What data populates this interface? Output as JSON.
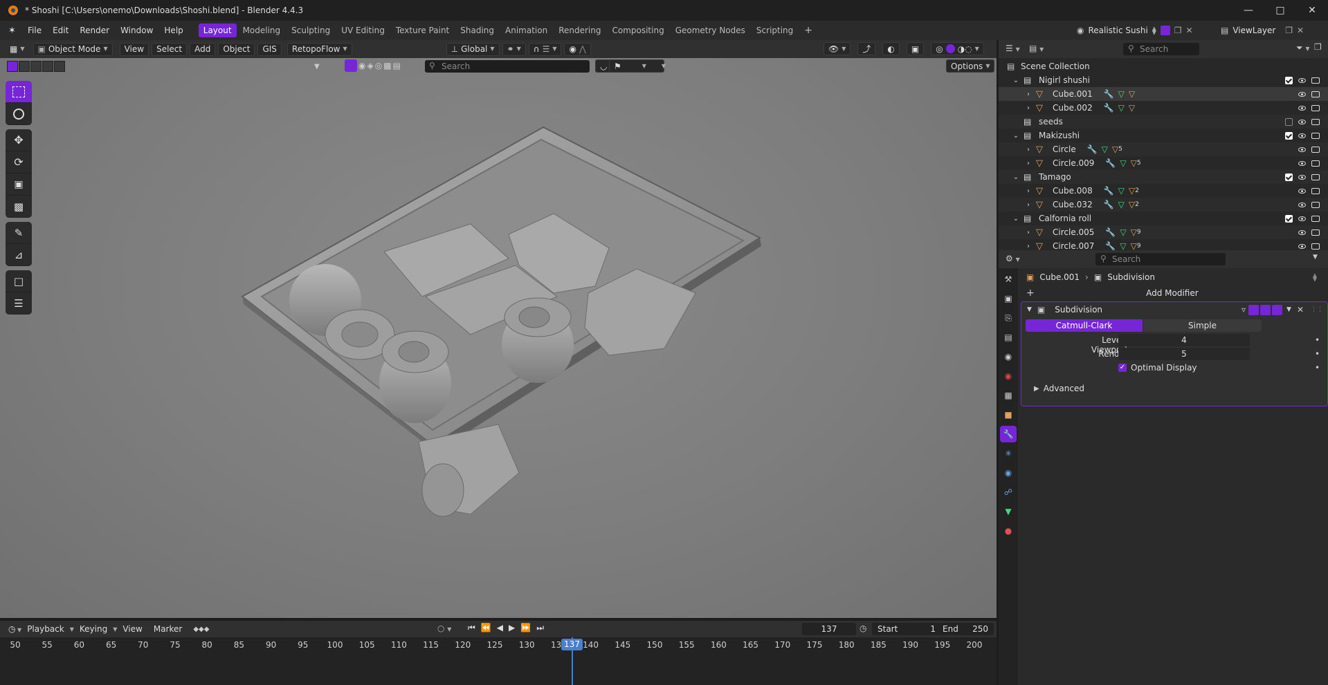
{
  "window": {
    "title": "* Shoshi [C:\\Users\\onemo\\Downloads\\Shoshi.blend] - Blender 4.4.3"
  },
  "menu": [
    "File",
    "Edit",
    "Render",
    "Window",
    "Help"
  ],
  "workspaces": [
    "Layout",
    "Modeling",
    "Sculpting",
    "UV Editing",
    "Texture Paint",
    "Shading",
    "Animation",
    "Rendering",
    "Compositing",
    "Geometry Nodes",
    "Scripting"
  ],
  "active_workspace": "Layout",
  "scene_name": "Realistic Sushi",
  "view_layer": "ViewLayer",
  "viewport_header": {
    "mode": "Object Mode",
    "menus": [
      "View",
      "Select",
      "Add",
      "Object",
      "GIS"
    ],
    "addon": "RetopoFlow",
    "transform_orientation": "Global",
    "search_placeholder": "Search",
    "options": "Options"
  },
  "outliner": {
    "search_placeholder": "Search",
    "root": "Scene Collection",
    "rows": [
      {
        "label": "Nigirl shushi",
        "kind": "collection",
        "indent": 0,
        "checked": true
      },
      {
        "label": "Cube.001",
        "kind": "object",
        "indent": 1,
        "sub": ""
      },
      {
        "label": "Cube.002",
        "kind": "object",
        "indent": 1,
        "sub": ""
      },
      {
        "label": "seeds",
        "kind": "collection",
        "indent": 0,
        "checked": false
      },
      {
        "label": "Makizushi",
        "kind": "collection",
        "indent": 0,
        "checked": true
      },
      {
        "label": "Circle",
        "kind": "object",
        "indent": 1,
        "sub": "5"
      },
      {
        "label": "Circle.009",
        "kind": "object",
        "indent": 1,
        "sub": "5"
      },
      {
        "label": "Tamago",
        "kind": "collection",
        "indent": 0,
        "checked": true
      },
      {
        "label": "Cube.008",
        "kind": "object",
        "indent": 1,
        "sub": "2"
      },
      {
        "label": "Cube.032",
        "kind": "object",
        "indent": 1,
        "sub": "2"
      },
      {
        "label": "Calfornia roll",
        "kind": "collection",
        "indent": 0,
        "checked": true
      },
      {
        "label": "Circle.005",
        "kind": "object",
        "indent": 1,
        "sub": "9"
      },
      {
        "label": "Circle.007",
        "kind": "object",
        "indent": 1,
        "sub": "9"
      }
    ]
  },
  "properties": {
    "search_placeholder": "Search",
    "breadcrumb_object": "Cube.001",
    "breadcrumb_modifier": "Subdivision",
    "add_modifier": "Add Modifier",
    "modifier": {
      "name": "Subdivision",
      "algorithms": [
        "Catmull-Clark",
        "Simple"
      ],
      "active_algorithm": "Catmull-Clark",
      "levels_viewport_label": "Levels Viewport",
      "levels_viewport": "4",
      "render_label": "Render",
      "render": "5",
      "optimal_display_label": "Optimal Display",
      "optimal_display": true,
      "advanced_label": "Advanced"
    }
  },
  "timeline": {
    "menus": [
      "Playback",
      "Keying",
      "View",
      "Marker"
    ],
    "current_frame": "137",
    "start_label": "Start",
    "start": "1",
    "end_label": "End",
    "end": "250",
    "ticks": [
      50,
      55,
      60,
      65,
      70,
      75,
      80,
      85,
      90,
      95,
      100,
      105,
      110,
      115,
      120,
      125,
      130,
      135,
      140,
      145,
      150,
      155,
      160,
      165,
      170,
      175,
      180,
      185,
      190,
      195,
      200
    ]
  },
  "colors": {
    "accent": "#7626d6",
    "playhead": "#4a7fd0",
    "object_icon": "#e0a060"
  }
}
